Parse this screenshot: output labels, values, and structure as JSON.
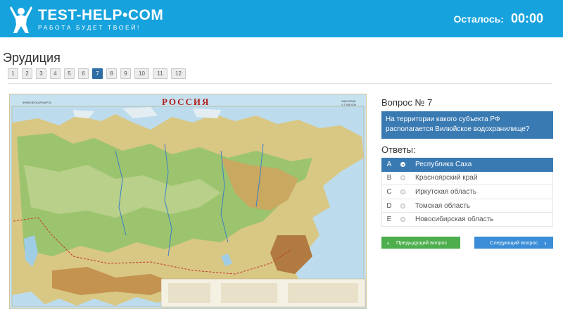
{
  "header": {
    "logo_title": "TEST-HELP•COM",
    "logo_subtitle": "РАБОТА БУДЕТ ТВОЕЙ!",
    "timer_label": "Осталось:",
    "timer_value": "00:00"
  },
  "test": {
    "title": "Эрудиция",
    "pages": [
      "1",
      "2",
      "3",
      "4",
      "5",
      "6",
      "7",
      "8",
      "9",
      "10",
      "11",
      "12"
    ],
    "active_page": "7"
  },
  "map": {
    "title": "РОССИЯ",
    "corner_left": "ФИЗИЧЕСКАЯ КАРТА",
    "scale_label": "МАСШТАБ",
    "scale_value": "1:7 500 000"
  },
  "question": {
    "number_label": "Вопрос № 7",
    "text": "На территории какого субъекта РФ располагается Вилюйское водохранилище?"
  },
  "answers": {
    "title": "Ответы:",
    "items": [
      {
        "letter": "A",
        "text": "Республика Саха"
      },
      {
        "letter": "B",
        "text": "Красноярский край"
      },
      {
        "letter": "C",
        "text": "Иркутская область"
      },
      {
        "letter": "D",
        "text": "Томская область"
      },
      {
        "letter": "E",
        "text": "Новосибирская область"
      }
    ],
    "selected": "A"
  },
  "nav": {
    "prev_label": "Предыдущий вопрос",
    "next_label": "Следующий вопрос"
  },
  "colors": {
    "header": "#16a2dd",
    "accent": "#3a7ab3",
    "prev_button": "#4cae4c",
    "next_button": "#3a8dd6"
  }
}
